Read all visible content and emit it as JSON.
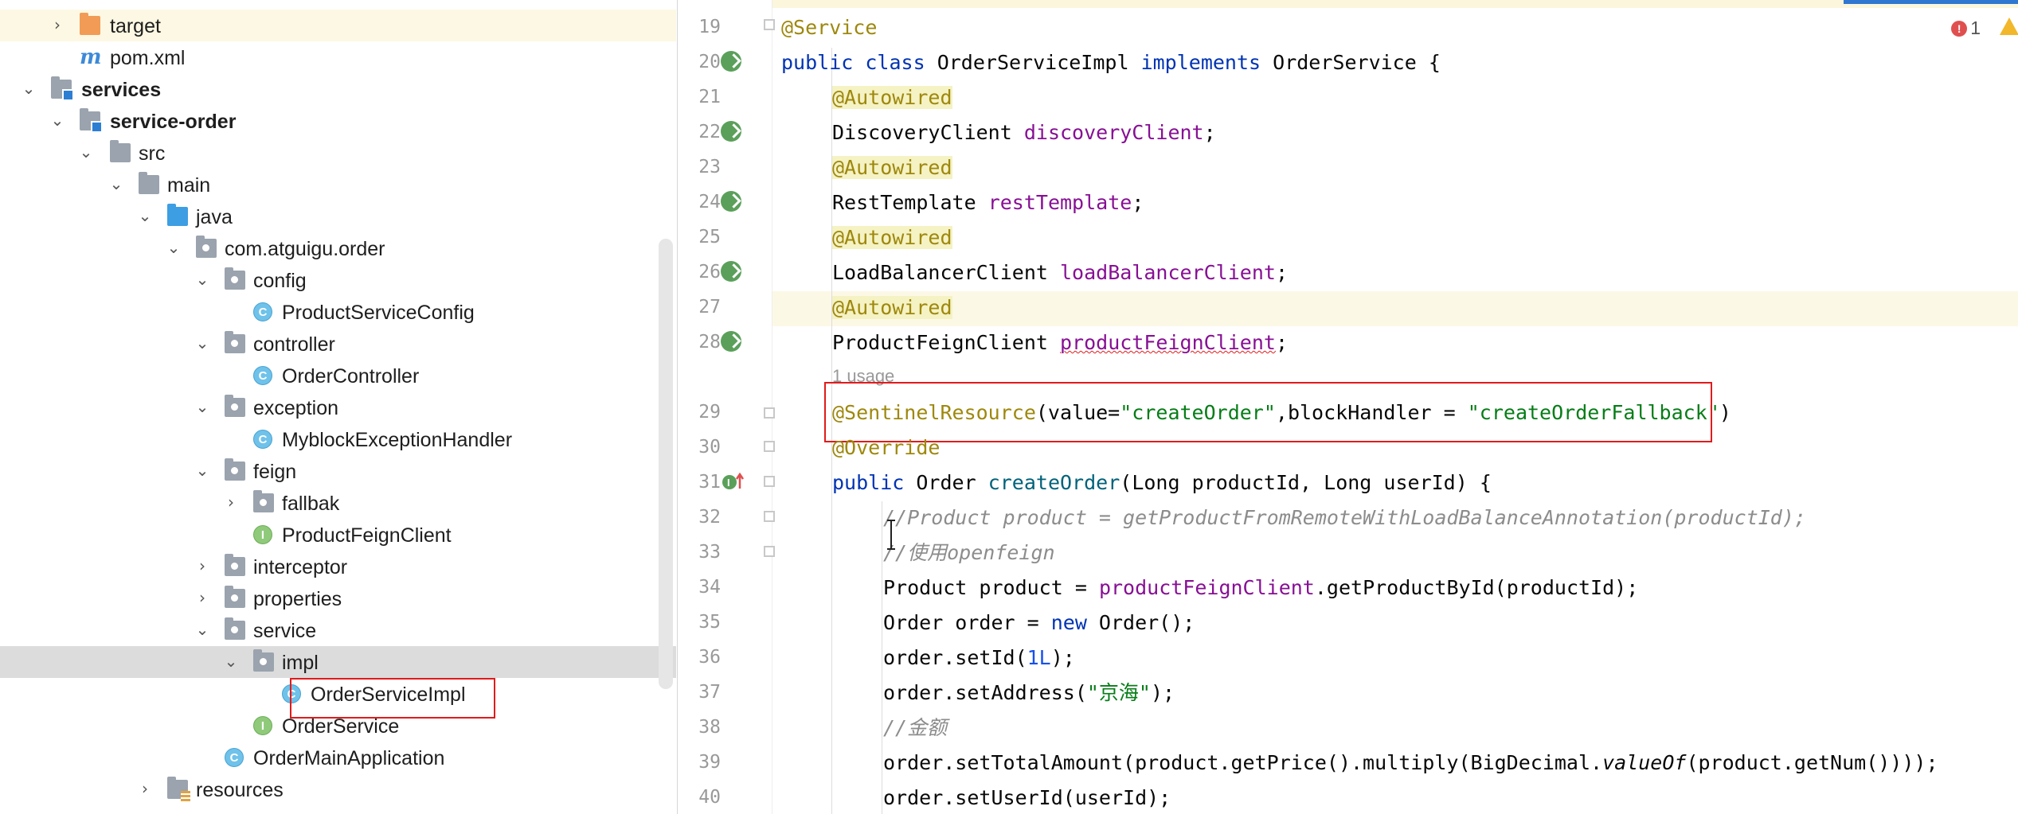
{
  "project_tree": {
    "items": [
      {
        "label": "target",
        "icon": "folder-orange-icon",
        "chevron": "collapsed"
      },
      {
        "label": "pom.xml",
        "icon": "maven-icon",
        "chevron": ""
      },
      {
        "label": "services",
        "icon": "module-folder-icon",
        "chevron": "expanded"
      },
      {
        "label": "service-order",
        "icon": "module-folder-icon",
        "chevron": "expanded"
      },
      {
        "label": "src",
        "icon": "folder-icon",
        "chevron": "expanded"
      },
      {
        "label": "main",
        "icon": "folder-icon",
        "chevron": "expanded"
      },
      {
        "label": "java",
        "icon": "source-folder-icon",
        "chevron": "expanded"
      },
      {
        "label": "com.atguigu.order",
        "icon": "package-icon",
        "chevron": "expanded"
      },
      {
        "label": "config",
        "icon": "package-icon",
        "chevron": "expanded"
      },
      {
        "label": "ProductServiceConfig",
        "icon": "class-icon",
        "chevron": ""
      },
      {
        "label": "controller",
        "icon": "package-icon",
        "chevron": "expanded"
      },
      {
        "label": "OrderController",
        "icon": "class-icon",
        "chevron": ""
      },
      {
        "label": "exception",
        "icon": "package-icon",
        "chevron": "expanded"
      },
      {
        "label": "MyblockExceptionHandler",
        "icon": "class-icon",
        "chevron": ""
      },
      {
        "label": "feign",
        "icon": "package-icon",
        "chevron": "expanded"
      },
      {
        "label": "fallbak",
        "icon": "package-icon",
        "chevron": "collapsed"
      },
      {
        "label": "ProductFeignClient",
        "icon": "interface-icon",
        "chevron": ""
      },
      {
        "label": "interceptor",
        "icon": "package-icon",
        "chevron": "collapsed"
      },
      {
        "label": "properties",
        "icon": "package-icon",
        "chevron": "collapsed"
      },
      {
        "label": "service",
        "icon": "package-icon",
        "chevron": "expanded"
      },
      {
        "label": "impl",
        "icon": "package-icon",
        "chevron": "expanded"
      },
      {
        "label": "OrderServiceImpl",
        "icon": "class-icon",
        "chevron": ""
      },
      {
        "label": "OrderService",
        "icon": "interface-icon",
        "chevron": ""
      },
      {
        "label": "OrderMainApplication",
        "icon": "spring-boot-class-icon",
        "chevron": ""
      },
      {
        "label": "resources",
        "icon": "resources-folder-icon",
        "chevron": "collapsed"
      }
    ],
    "selected": "impl"
  },
  "editor": {
    "line_numbers": [
      "19",
      "20",
      "21",
      "22",
      "23",
      "24",
      "25",
      "26",
      "27",
      "28",
      "29",
      "30",
      "31",
      "32",
      "33",
      "34",
      "35",
      "36",
      "37",
      "38",
      "39",
      "40"
    ],
    "usage_hint": "1 usage",
    "error_count": "1",
    "code": {
      "l19": "@Service",
      "l20": {
        "kw1": "public class",
        "name": "OrderServiceImpl",
        "kw2": "implements",
        "rest": "OrderService {"
      },
      "l21": "@Autowired",
      "l22": {
        "type": "DiscoveryClient",
        "field": "discoveryClient",
        "end": ";"
      },
      "l23": "@Autowired",
      "l24": {
        "type": "RestTemplate",
        "field": "restTemplate",
        "end": ";"
      },
      "l25": "@Autowired",
      "l26": {
        "type": "LoadBalancerClient",
        "field": "loadBalancerClient",
        "end": ";"
      },
      "l27": "@Autowired",
      "l28": {
        "type": "ProductFeignClient",
        "field": "productFeignClient",
        "end": ";"
      },
      "l29": {
        "ann": "@SentinelResource",
        "p1": "(value=",
        "s1": "\"createOrder\"",
        "p2": ",blockHandler = ",
        "s2": "\"createOrderFallback\"",
        "p3": ")"
      },
      "l30": "@Override",
      "l31": {
        "kw": "public",
        "type": "Order",
        "method": "createOrder",
        "rest": "(Long productId, Long userId) {"
      },
      "l32": "//Product product = getProductFromRemoteWithLoadBalanceAnnotation(productId);",
      "l33": "//使用openfeign",
      "l34": {
        "p1": "Product product = ",
        "field": "productFeignClient",
        "p2": ".getProductById(productId);"
      },
      "l35": {
        "p1": "Order order = ",
        "kw": "new",
        "p2": " Order();"
      },
      "l36": {
        "p1": "order.setId(",
        "num": "1L",
        "p2": ");"
      },
      "l37": {
        "p1": "order.setAddress(",
        "str": "\"京海\"",
        "p2": ");"
      },
      "l38": "//金额",
      "l39": {
        "p1": "order.setTotalAmount(product.getPrice().multiply(BigDecimal.",
        "st": "valueOf",
        "p2": "(product.getNum())));"
      },
      "l40": "order.setUserId(userId);"
    }
  },
  "colors": {
    "keyword": "#0033b3",
    "annotation": "#9e880d",
    "field": "#871094",
    "string": "#067d17",
    "number": "#1750eb",
    "comment": "#8c8c8c",
    "highlight_box": "#e11b1b",
    "selected_row": "#dcdcdc"
  }
}
